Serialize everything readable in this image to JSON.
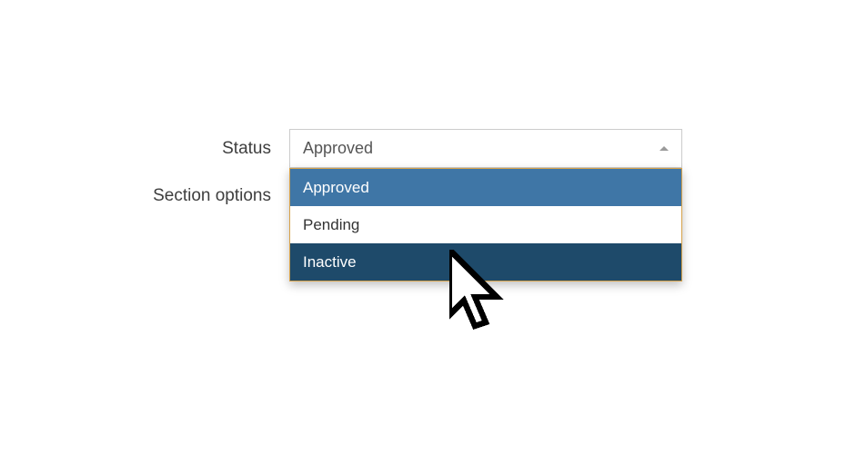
{
  "form": {
    "status_label": "Status",
    "section_label": "Section options",
    "status_selected": "Approved",
    "dropdown": {
      "options": [
        {
          "label": "Approved",
          "state": "selected"
        },
        {
          "label": "Pending",
          "state": ""
        },
        {
          "label": "Inactive",
          "state": "hovered"
        }
      ]
    }
  }
}
